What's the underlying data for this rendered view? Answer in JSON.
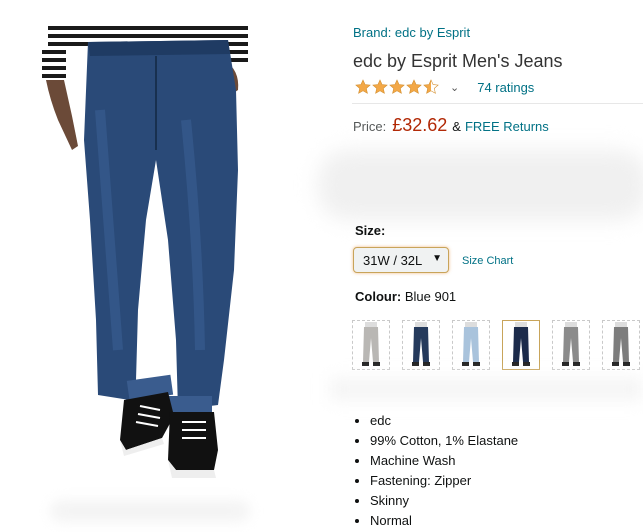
{
  "product": {
    "brand_link": "Brand: edc by Esprit",
    "title": "edc by Esprit Men's Jeans",
    "rating_stars": 4.5,
    "ratings_count": "74 ratings",
    "price_label": "Price:",
    "price": "£32.62",
    "price_amp": "&",
    "free_returns": "FREE Returns"
  },
  "size": {
    "label": "Size:",
    "selected": "31W / 32L",
    "chart_link": "Size Chart"
  },
  "colour": {
    "label": "Colour:",
    "selected": "Blue 901",
    "swatches": [
      {
        "color": "#b9b7b4"
      },
      {
        "color": "#253a5c"
      },
      {
        "color": "#a9c3dc"
      },
      {
        "color": "#1c2b4b",
        "selected": true
      },
      {
        "color": "#8b8b8b"
      },
      {
        "color": "#7d7d7d"
      }
    ]
  },
  "bullets": [
    "edc",
    "99% Cotton, 1% Elastane",
    "Machine Wash",
    "Fastening: Zipper",
    "Skinny",
    "Normal"
  ],
  "colors": {
    "link": "#007185",
    "price": "#b12704",
    "star": "#f3a847"
  }
}
